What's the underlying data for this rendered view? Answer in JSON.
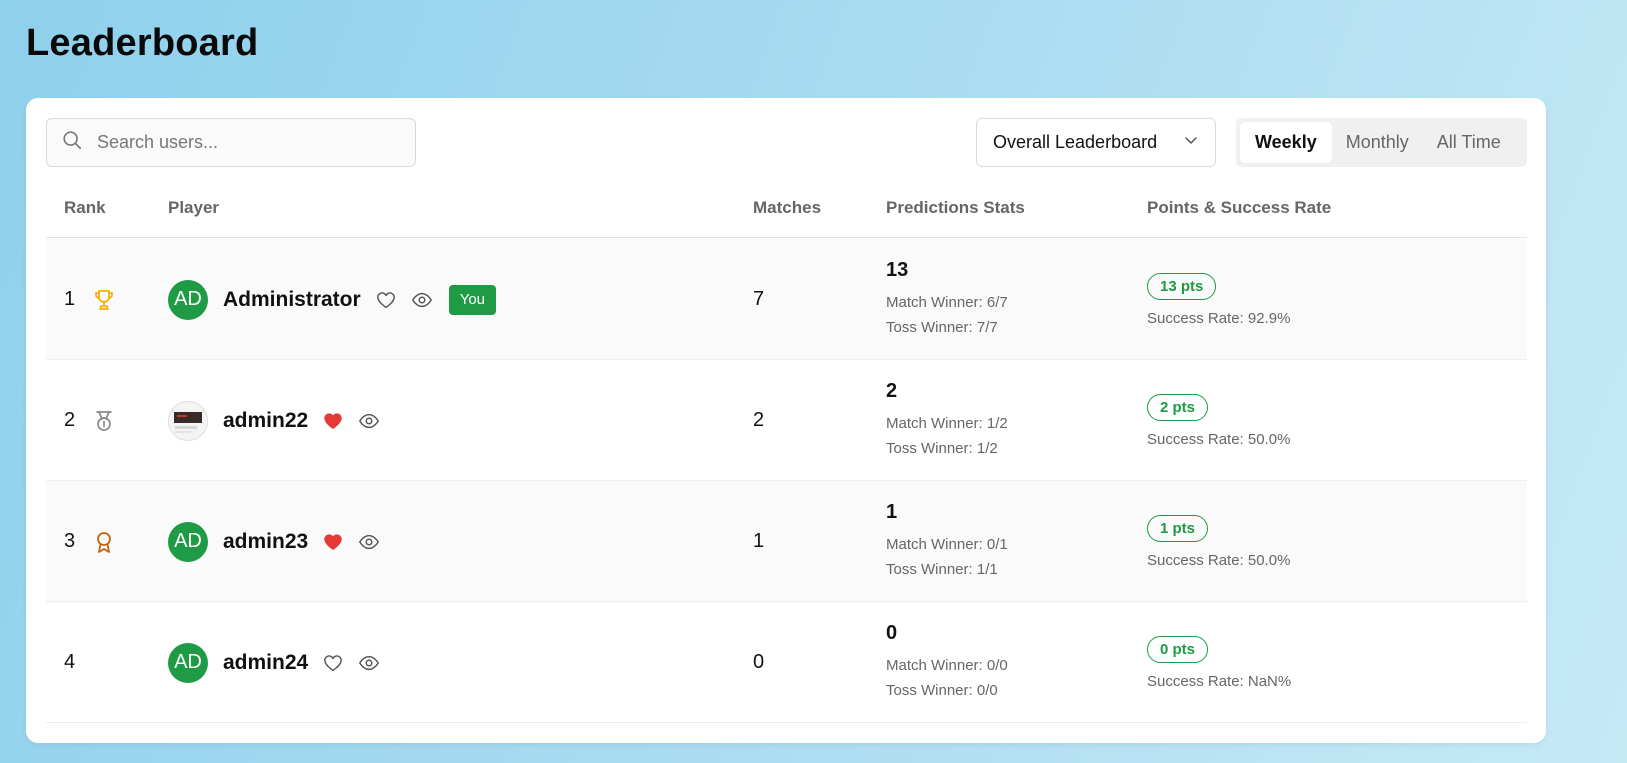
{
  "page": {
    "title": "Leaderboard"
  },
  "search": {
    "placeholder": "Search users..."
  },
  "filter": {
    "selected": "Overall Leaderboard"
  },
  "periods": {
    "items": [
      "Weekly",
      "Monthly",
      "All Time"
    ],
    "active": "Weekly"
  },
  "table": {
    "headers": {
      "rank": "Rank",
      "player": "Player",
      "matches": "Matches",
      "predictions": "Predictions Stats",
      "points": "Points & Success Rate"
    },
    "rows": [
      {
        "rank": "1",
        "rank_icon": "trophy-icon",
        "avatar": "AD",
        "name": "Administrator",
        "favorite": false,
        "you_badge": "You",
        "matches": "7",
        "total": "13",
        "match_winner": "Match Winner: 6/7",
        "toss_winner": "Toss Winner: 7/7",
        "points": "13 pts",
        "success_rate": "Success Rate: 92.9%"
      },
      {
        "rank": "2",
        "rank_icon": "medal-icon",
        "avatar": "",
        "name": "admin22",
        "favorite": true,
        "matches": "2",
        "total": "2",
        "match_winner": "Match Winner: 1/2",
        "toss_winner": "Toss Winner: 1/2",
        "points": "2 pts",
        "success_rate": "Success Rate: 50.0%"
      },
      {
        "rank": "3",
        "rank_icon": "award-icon",
        "avatar": "AD",
        "name": "admin23",
        "favorite": true,
        "matches": "1",
        "total": "1",
        "match_winner": "Match Winner: 0/1",
        "toss_winner": "Toss Winner: 1/1",
        "points": "1 pts",
        "success_rate": "Success Rate: 50.0%"
      },
      {
        "rank": "4",
        "rank_icon": "",
        "avatar": "AD",
        "name": "admin24",
        "favorite": false,
        "matches": "0",
        "total": "0",
        "match_winner": "Match Winner: 0/0",
        "toss_winner": "Toss Winner: 0/0",
        "points": "0 pts",
        "success_rate": "Success Rate: NaN%"
      }
    ]
  },
  "colors": {
    "accent_green": "#1f9a45",
    "heart_red": "#e53935",
    "trophy_gold": "#f0b400",
    "medal_silver": "#8a8a8a",
    "award_bronze": "#c0650f"
  }
}
